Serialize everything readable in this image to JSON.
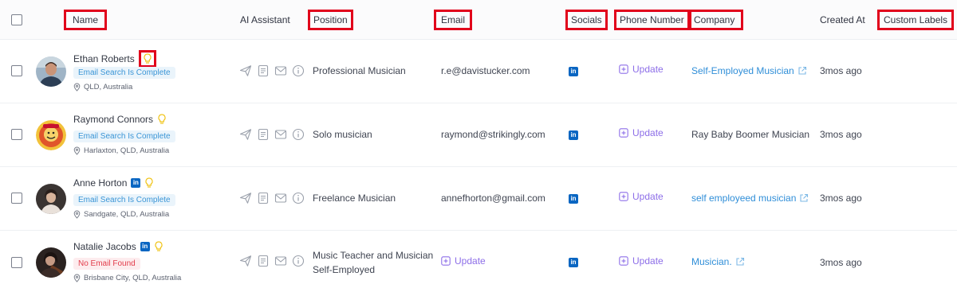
{
  "columns": {
    "name": "Name",
    "ai_assistant": "AI Assistant",
    "position": "Position",
    "email": "Email",
    "socials": "Socials",
    "phone": "Phone Number",
    "company": "Company",
    "created_at": "Created At",
    "custom_labels": "Custom Labels"
  },
  "rows": [
    {
      "name": "Ethan Roberts",
      "status": "Email Search Is Complete",
      "location": "QLD, Australia",
      "position_line1": "Professional Musician",
      "position_line2": "",
      "email": "r.e@davistucker.com",
      "phone": "Update",
      "company": "Self-Employed Musician",
      "created": "3mos ago"
    },
    {
      "name": "Raymond Connors",
      "status": "Email Search Is Complete",
      "location": "Harlaxton, QLD, Australia",
      "position_line1": "Solo musician",
      "position_line2": "",
      "email": "raymond@strikingly.com",
      "phone": "Update",
      "company": "Ray Baby Boomer Musician",
      "created": "3mos ago"
    },
    {
      "name": "Anne Horton",
      "status": "Email Search Is Complete",
      "location": "Sandgate, QLD, Australia",
      "position_line1": "Freelance Musician",
      "position_line2": "",
      "email": "annefhorton@gmail.com",
      "phone": "Update",
      "company": "self employeed musician",
      "created": "3mos ago"
    },
    {
      "name": "Natalie Jacobs",
      "status": "No Email Found",
      "location": "Brisbane City, QLD, Australia",
      "position_line1": "Music Teacher and Musician",
      "position_line2": "Self-Employed",
      "email_action": "Update",
      "phone": "Update",
      "company": "Musician.",
      "created": "3mos ago"
    }
  ],
  "icons": {
    "linkedin": "in",
    "send": "send-icon",
    "note": "note-icon",
    "mail": "mail-icon",
    "info": "info-icon",
    "bulb": "lightbulb-icon",
    "pin": "location-pin-icon",
    "external": "external-link-icon",
    "plus": "plus-square-icon"
  },
  "colors": {
    "highlight": "#e1001b",
    "link": "#2f8ed8",
    "update": "#8d6ee8",
    "linkedin": "#0a66c2",
    "ok_badge": "#3a95d6",
    "err_badge": "#e23c4b"
  }
}
